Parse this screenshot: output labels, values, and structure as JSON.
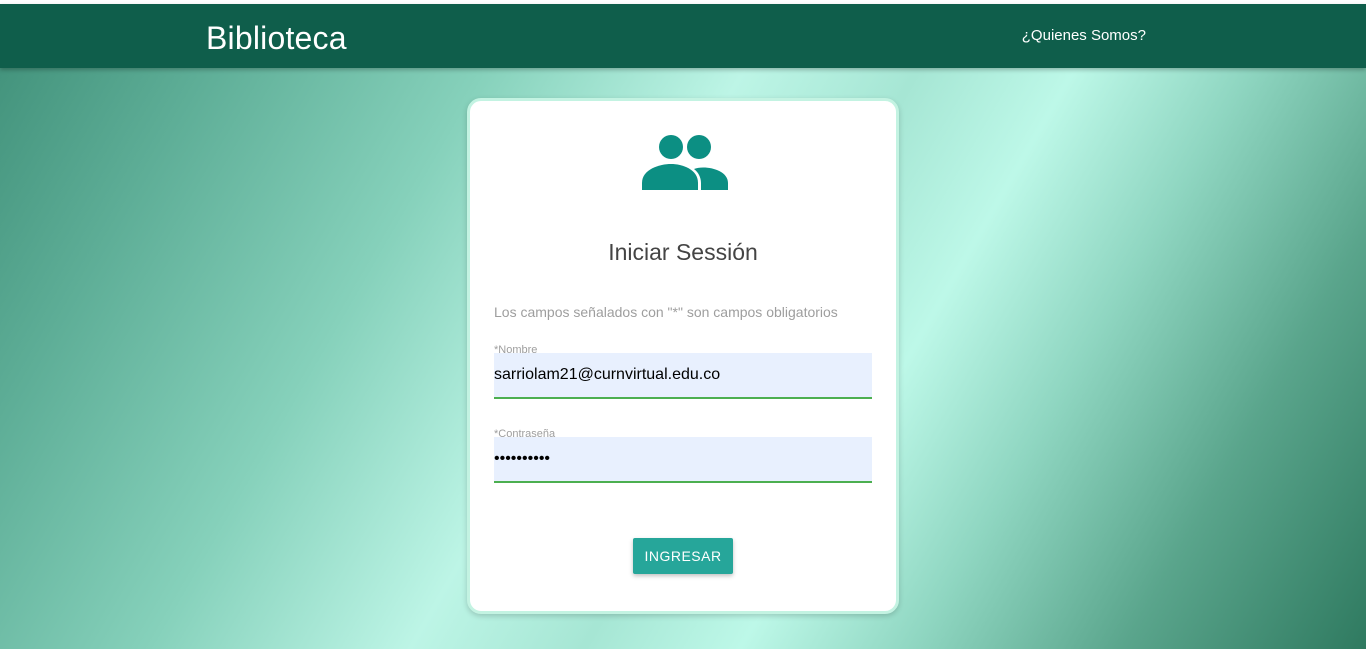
{
  "navbar": {
    "brand": "Biblioteca",
    "link_label": "¿Quienes Somos?",
    "background_color": "#0f5e4b"
  },
  "login": {
    "icon": "users-icon",
    "icon_color": "#0c8f83",
    "title": "Iniciar Sessión",
    "hint": "Los campos señalados con \"*\" son campos obligatorios",
    "fields": [
      {
        "label": "*Nombre",
        "value": "sarriolam21@curnvirtual.edu.co",
        "type": "text"
      },
      {
        "label": "*Contraseña",
        "value": "••••••••••",
        "type": "password"
      }
    ],
    "submit_label": "INGRESAR",
    "button_color": "#26a69a",
    "field_underline_color": "#4caf50"
  }
}
